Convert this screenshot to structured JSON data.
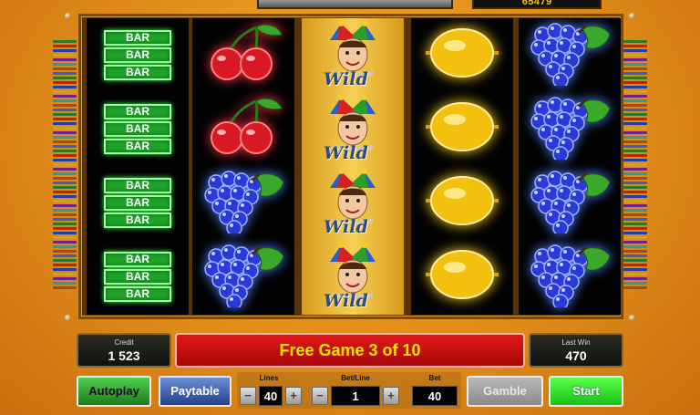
{
  "top": {
    "counter_partial": "65479"
  },
  "reels": [
    {
      "background": "black",
      "symbols": [
        "bar",
        "bar",
        "bar",
        "bar"
      ]
    },
    {
      "background": "black",
      "symbols": [
        "cherry",
        "cherry",
        "grape",
        "grape"
      ]
    },
    {
      "background": "gold",
      "symbols": [
        "joker-wild",
        "joker-wild",
        "joker-wild",
        "joker-wild"
      ]
    },
    {
      "background": "black",
      "symbols": [
        "lemon",
        "lemon",
        "lemon",
        "lemon"
      ]
    },
    {
      "background": "black",
      "symbols": [
        "grape",
        "grape",
        "grape",
        "grape"
      ]
    }
  ],
  "symbols": {
    "bar_text": "BAR",
    "wild_text": "Wild"
  },
  "credit": {
    "label": "Credit",
    "value": "1 523"
  },
  "message": "Free Game 3 of 10",
  "last_win": {
    "label": "Last Win",
    "value": "470"
  },
  "buttons": {
    "autoplay": "Autoplay",
    "paytable": "Paytable",
    "gamble": "Gamble",
    "start": "Start"
  },
  "controls": {
    "lines_label": "Lines",
    "lines_value": "40",
    "bet_line_label": "Bet/Line",
    "bet_line_value": "1",
    "bet_label": "Bet",
    "bet_value": "40",
    "minus": "−",
    "plus": "+"
  },
  "colors": {
    "background": "#e5921c",
    "message_bg": "#c81010",
    "message_text": "#ffe600",
    "start_green": "#2ee12a",
    "autoplay_green": "#2a9a2a",
    "paytable_blue": "#3a5cb0"
  }
}
